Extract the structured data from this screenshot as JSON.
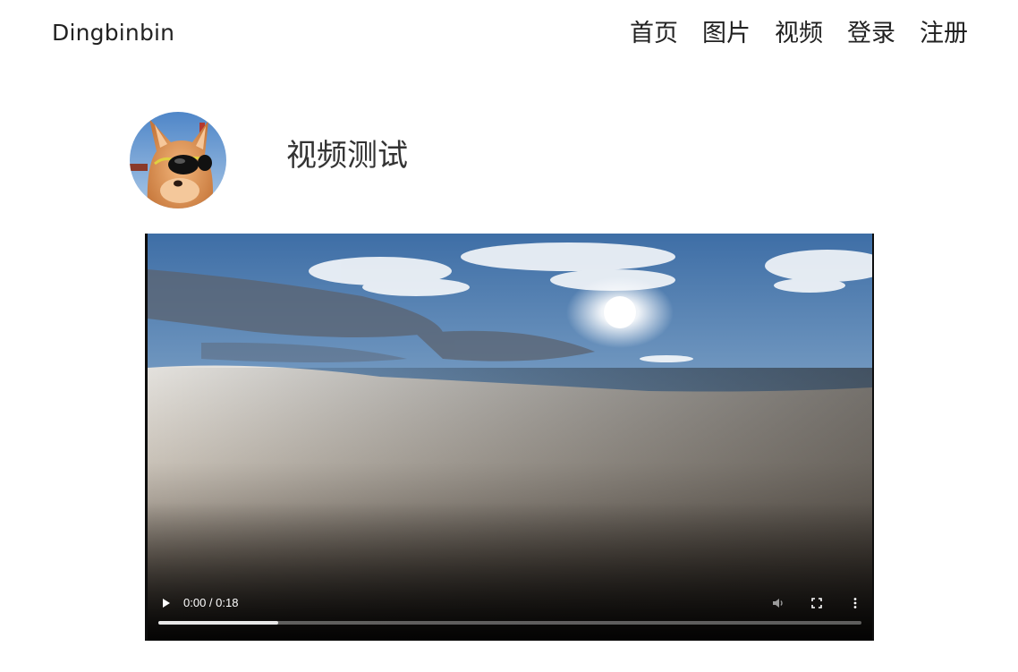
{
  "header": {
    "brand": "Dingbinbin",
    "nav": [
      "首页",
      "图片",
      "视频",
      "登录",
      "注册"
    ]
  },
  "post": {
    "title": "视频测试"
  },
  "video": {
    "time_display": "0:00 / 0:18",
    "buffered_fraction": 0.17
  }
}
